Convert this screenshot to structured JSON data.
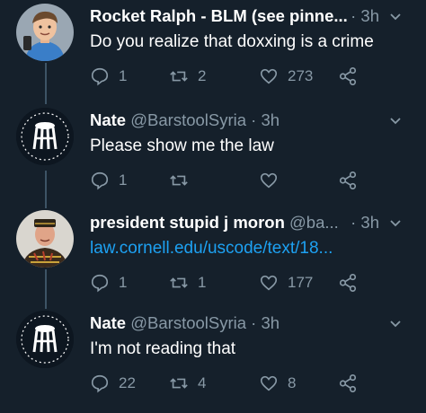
{
  "colors": {
    "background": "#15202b",
    "text": "#ffffff",
    "muted": "#8899a6",
    "link": "#1da1f2",
    "thread_line": "#3d5466"
  },
  "tweets": [
    {
      "name": "Rocket Ralph - BLM (see pinne...",
      "handle": "",
      "time": "· 3h",
      "text": "Do you realize that doxxing is a crime",
      "text_is_link": false,
      "replies": "1",
      "retweets": "2",
      "likes": "273",
      "avatar": "cartoon-boy-avatar"
    },
    {
      "name": "Nate",
      "handle": "@BarstoolSyria · 3h",
      "time": "",
      "text": "Please show me the law",
      "text_is_link": false,
      "replies": "1",
      "retweets": "",
      "likes": "",
      "avatar": "barstool-logo-avatar"
    },
    {
      "name": "president stupid j moron",
      "handle": "@ba...",
      "time": "· 3h",
      "text": "law.cornell.edu/uscode/text/18...",
      "text_is_link": true,
      "replies": "1",
      "retweets": "1",
      "likes": "177",
      "avatar": "man-photo-avatar"
    },
    {
      "name": "Nate",
      "handle": "@BarstoolSyria · 3h",
      "time": "",
      "text": "I'm not reading that",
      "text_is_link": false,
      "replies": "22",
      "retweets": "4",
      "likes": "8",
      "avatar": "barstool-logo-avatar"
    }
  ]
}
